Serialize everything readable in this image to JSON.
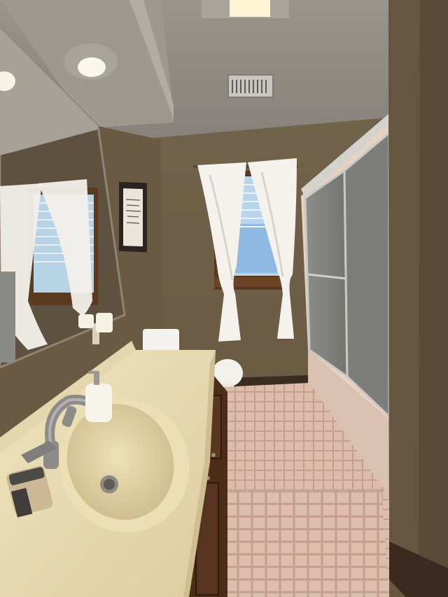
{
  "scene": {
    "description_type": "photo",
    "palette": {
      "wall": "#6f6048",
      "wall_shadow": "#5a4d3a",
      "ceiling": "#8f8a80",
      "vanity_top": "#e7d9b0",
      "cabinet": "#4a2c18",
      "tile": "#d9b8a4",
      "grout": "#bfa08c",
      "glass": "#8a8a86",
      "curtain": "#f4f1ec",
      "window_sky": "#9fc3e6",
      "door_frame": "#5b4a36"
    }
  }
}
